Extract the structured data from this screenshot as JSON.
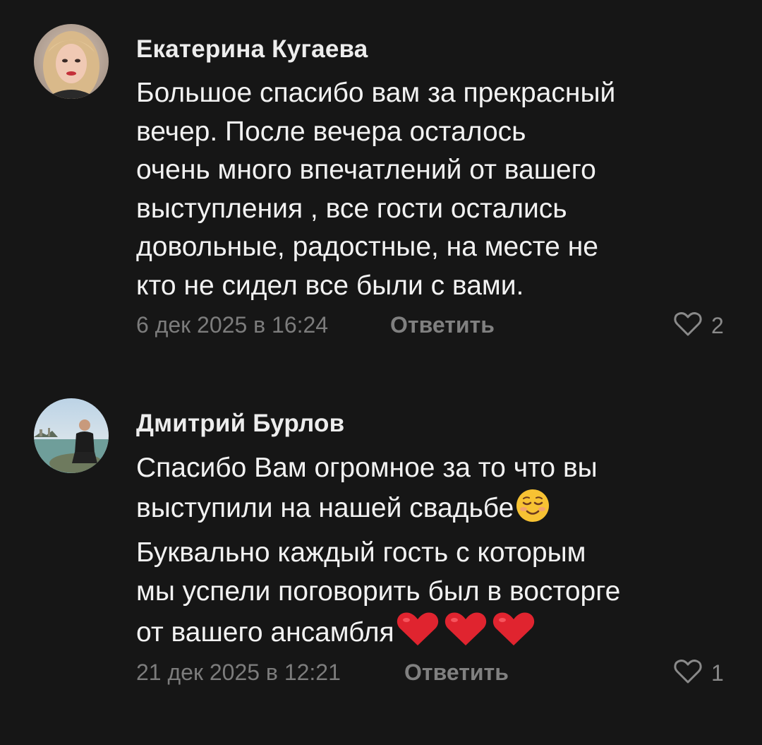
{
  "comments": [
    {
      "author": "Екатерина Кугаева",
      "text_lines": [
        "Большое спасибо вам за прекрасный",
        "вечер. После вечера осталось",
        "очень много впечатлений от вашего",
        "выступления , все гости остались",
        "довольные, радостные, на месте не",
        "кто не сидел все были с вами."
      ],
      "date": "6 дек 2025 в 16:24",
      "reply_label": "Ответить",
      "likes": "2"
    },
    {
      "author": "Дмитрий Бурлов",
      "text_lines": [
        "Спасибо Вам огромное за то что вы",
        "выступили на нашей свадьбе",
        "Буквально каждый гость с которым",
        "мы успели поговорить был в восторге",
        "от вашего ансамбля"
      ],
      "date": "21 дек 2025 в 12:21",
      "reply_label": "Ответить",
      "likes": "1"
    }
  ],
  "icons": {
    "like": "heart-outline-icon",
    "emoji_smile": "smiling-face-icon",
    "emoji_heart": "red-heart-icon"
  },
  "colors": {
    "background": "#161616",
    "text": "#f2f2f2",
    "muted": "#7c7c7c",
    "heart_emoji": "#e0242f"
  }
}
